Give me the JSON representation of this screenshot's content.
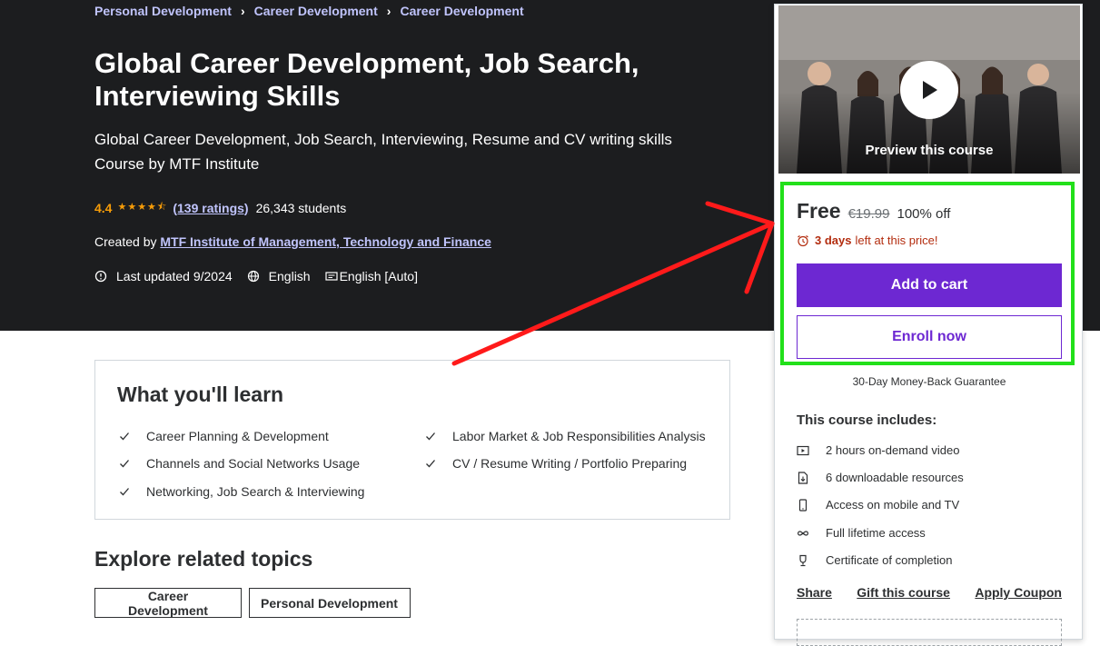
{
  "breadcrumb": [
    "Personal Development",
    "Career Development",
    "Career Development"
  ],
  "course": {
    "title": "Global Career Development, Job Search, Interviewing Skills",
    "subtitle": "Global Career Development, Job Search, Interviewing, Resume and CV writing skills Course by MTF Institute",
    "rating": "4.4",
    "ratings_count": "(139 ratings)",
    "students": "26,343 students",
    "created_by_label": "Created by",
    "author": "MTF Institute of Management, Technology and Finance",
    "last_updated": "Last updated 9/2024",
    "language": "English",
    "captions": "English [Auto]"
  },
  "learn": {
    "title": "What you'll learn",
    "items": [
      "Career Planning & Development",
      "Labor Market & Job Responsibilities Analysis",
      "Channels and Social Networks Usage",
      "CV / Resume Writing / Portfolio Preparing",
      "Networking, Job Search & Interviewing"
    ]
  },
  "related": {
    "title": "Explore related topics",
    "topics": [
      "Career Development",
      "Personal Development"
    ]
  },
  "sidebar": {
    "preview_label": "Preview this course",
    "price": "Free",
    "original_price": "€19.99",
    "discount": "100% off",
    "timer_days": "3 days",
    "timer_rest": "left at this price!",
    "add_to_cart": "Add to cart",
    "enroll_now": "Enroll now",
    "guarantee": "30-Day Money-Back Guarantee",
    "includes_title": "This course includes:",
    "includes": [
      "2 hours on-demand video",
      "6 downloadable resources",
      "Access on mobile and TV",
      "Full lifetime access",
      "Certificate of completion"
    ],
    "share": "Share",
    "gift": "Gift this course",
    "coupon": "Apply Coupon"
  },
  "colors": {
    "accent": "#6d28d2",
    "rating": "#f69c08",
    "annotation_box": "#22e01a",
    "annotation_arrow": "#ff1a1a"
  }
}
